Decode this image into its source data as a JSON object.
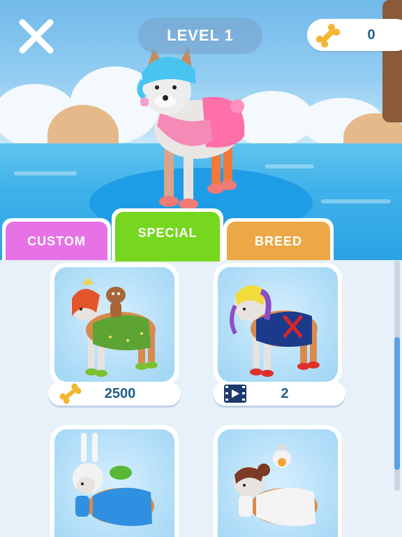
{
  "header": {
    "level_label": "LEVEL 1",
    "currency_value": "0",
    "currency_icon": "bone-icon",
    "close_icon": "close-icon"
  },
  "tabs": [
    {
      "label": "CUSTOM",
      "color": "#e772e6",
      "active": false
    },
    {
      "label": "SPECIAL",
      "color": "#77d61e",
      "active": true
    },
    {
      "label": "BREED",
      "color": "#eba844",
      "active": false
    }
  ],
  "items": [
    {
      "price_icon": "bone-icon",
      "price": "2500",
      "outfit": "gingerbread rider, green dress"
    },
    {
      "price_icon": "video-ad-icon",
      "price": "2",
      "outfit": "blonde-purple hair, navy dress"
    },
    {
      "price_icon": "",
      "price": "",
      "outfit": "bunny hood, blue dress"
    },
    {
      "price_icon": "",
      "price": "",
      "outfit": "brown buns, white dress, droid"
    }
  ],
  "colors": {
    "bone": "#f2b632",
    "value_text": "#1f5e8c",
    "panel_bg": "#e8f1f9"
  }
}
